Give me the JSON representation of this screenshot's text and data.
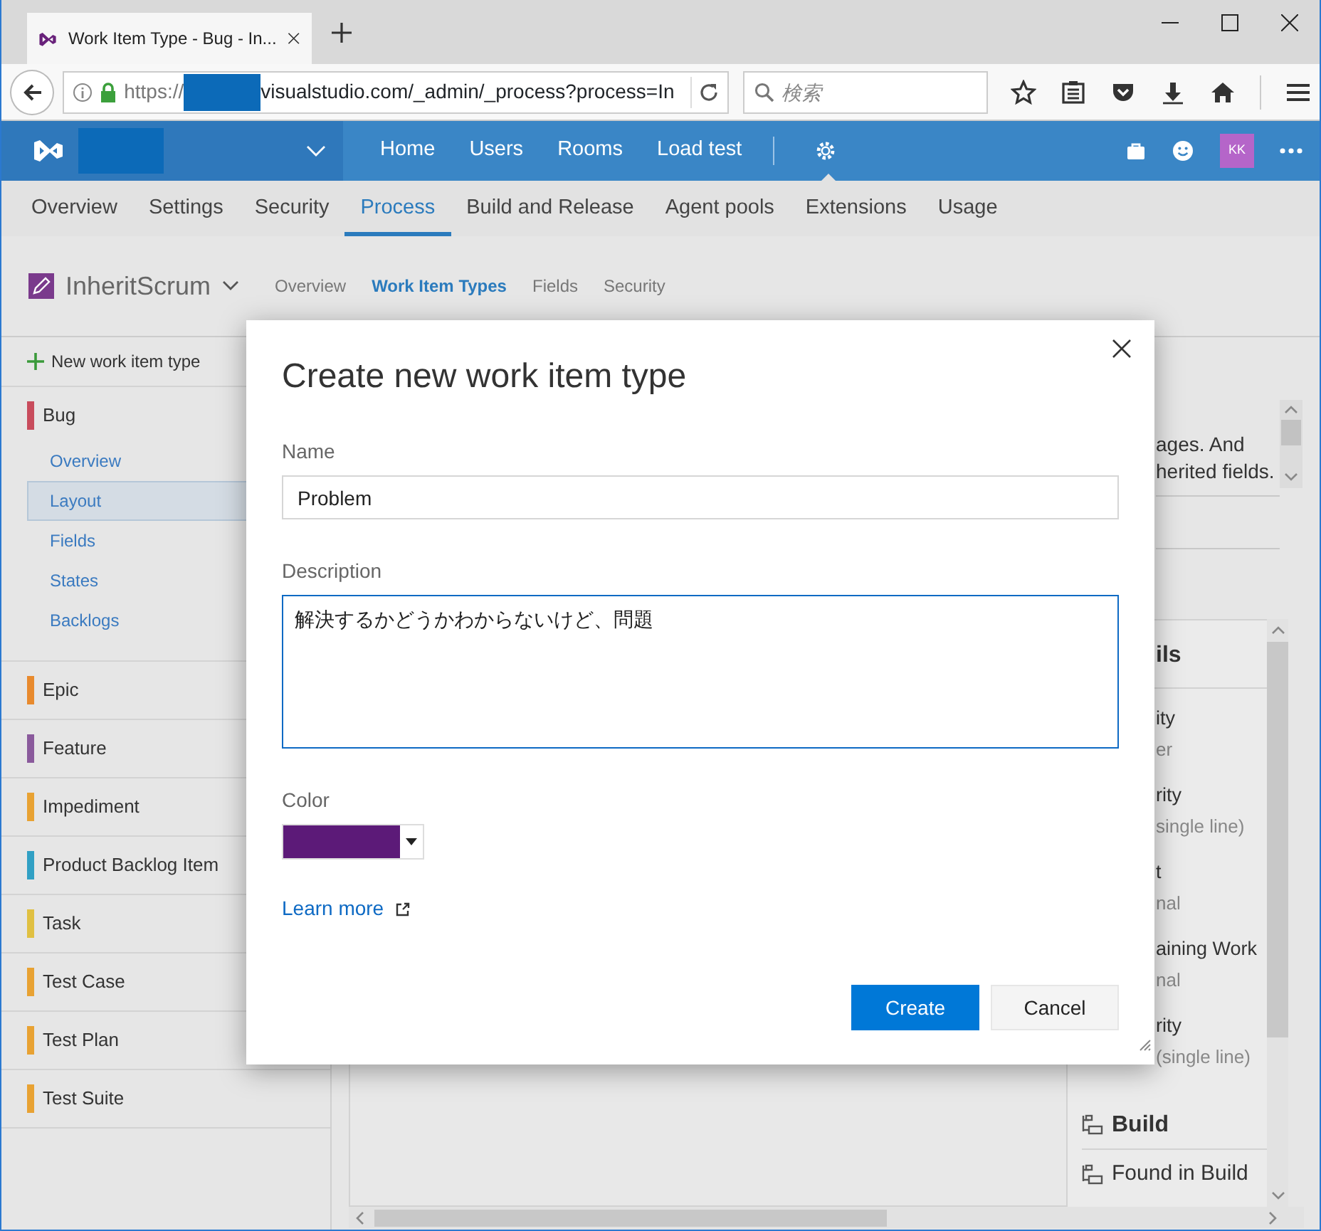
{
  "browser": {
    "tab_title": "Work Item Type - Bug - In...",
    "url_prefix": "https://",
    "url_rest": "visualstudio.com/_admin/_process?process=In",
    "search_placeholder": "検索"
  },
  "top_nav": {
    "items": [
      {
        "label": "Home",
        "selected": false
      },
      {
        "label": "Users",
        "selected": false
      },
      {
        "label": "Rooms",
        "selected": false
      },
      {
        "label": "Load test",
        "selected": false
      }
    ],
    "settings_selected": true,
    "avatar_initials": "KK"
  },
  "admin_tabs": [
    {
      "label": "Overview",
      "selected": false
    },
    {
      "label": "Settings",
      "selected": false
    },
    {
      "label": "Security",
      "selected": false
    },
    {
      "label": "Process",
      "selected": true
    },
    {
      "label": "Build and Release",
      "selected": false
    },
    {
      "label": "Agent pools",
      "selected": false
    },
    {
      "label": "Extensions",
      "selected": false
    },
    {
      "label": "Usage",
      "selected": false
    }
  ],
  "process": {
    "name": "InheritScrum",
    "tabs": [
      {
        "label": "Overview",
        "selected": false
      },
      {
        "label": "Work Item Types",
        "selected": true
      },
      {
        "label": "Fields",
        "selected": false
      },
      {
        "label": "Security",
        "selected": false
      }
    ]
  },
  "sidebar": {
    "new_button": "New work item type",
    "items": [
      {
        "label": "Bug",
        "color": "#c84c5c",
        "children": [
          {
            "label": "Overview",
            "selected": false
          },
          {
            "label": "Layout",
            "selected": true
          },
          {
            "label": "Fields",
            "selected": false
          },
          {
            "label": "States",
            "selected": false
          },
          {
            "label": "Backlogs",
            "selected": false
          }
        ]
      },
      {
        "label": "Epic",
        "color": "#e88a2e"
      },
      {
        "label": "Feature",
        "color": "#8a5a9c"
      },
      {
        "label": "Impediment",
        "color": "#e8a233"
      },
      {
        "label": "Product Backlog Item",
        "color": "#31a0c4"
      },
      {
        "label": "Task",
        "color": "#e0c042"
      },
      {
        "label": "Test Case",
        "color": "#e8a233"
      },
      {
        "label": "Test Plan",
        "color": "#e8a233"
      },
      {
        "label": "Test Suite",
        "color": "#e8a233"
      }
    ]
  },
  "background": {
    "info_lines": [
      "ages. And",
      "herited fields."
    ],
    "details_heading": "ils",
    "fields": [
      {
        "name": "ity",
        "type": "er"
      },
      {
        "name": "rity",
        "type": "single line)"
      },
      {
        "name": "t",
        "type": "nal"
      },
      {
        "name": "aining Work",
        "type": "nal"
      },
      {
        "name": "rity",
        "type": "(single line)"
      }
    ],
    "group": {
      "heading": "Build",
      "fields": [
        "Found in Build"
      ]
    }
  },
  "dialog": {
    "title": "Create new work item type",
    "fields": [
      {
        "kind": "text",
        "label": "Name",
        "value": "Problem",
        "focused": false
      },
      {
        "kind": "textarea",
        "label": "Description",
        "value": "解決するかどうかわからないけど、問題",
        "focused": true
      },
      {
        "kind": "color",
        "label": "Color",
        "color": "#5c1a78"
      }
    ],
    "link": "Learn more",
    "buttons": [
      {
        "label": "Create",
        "kind": "primary"
      },
      {
        "label": "Cancel",
        "kind": "secondary"
      }
    ]
  }
}
